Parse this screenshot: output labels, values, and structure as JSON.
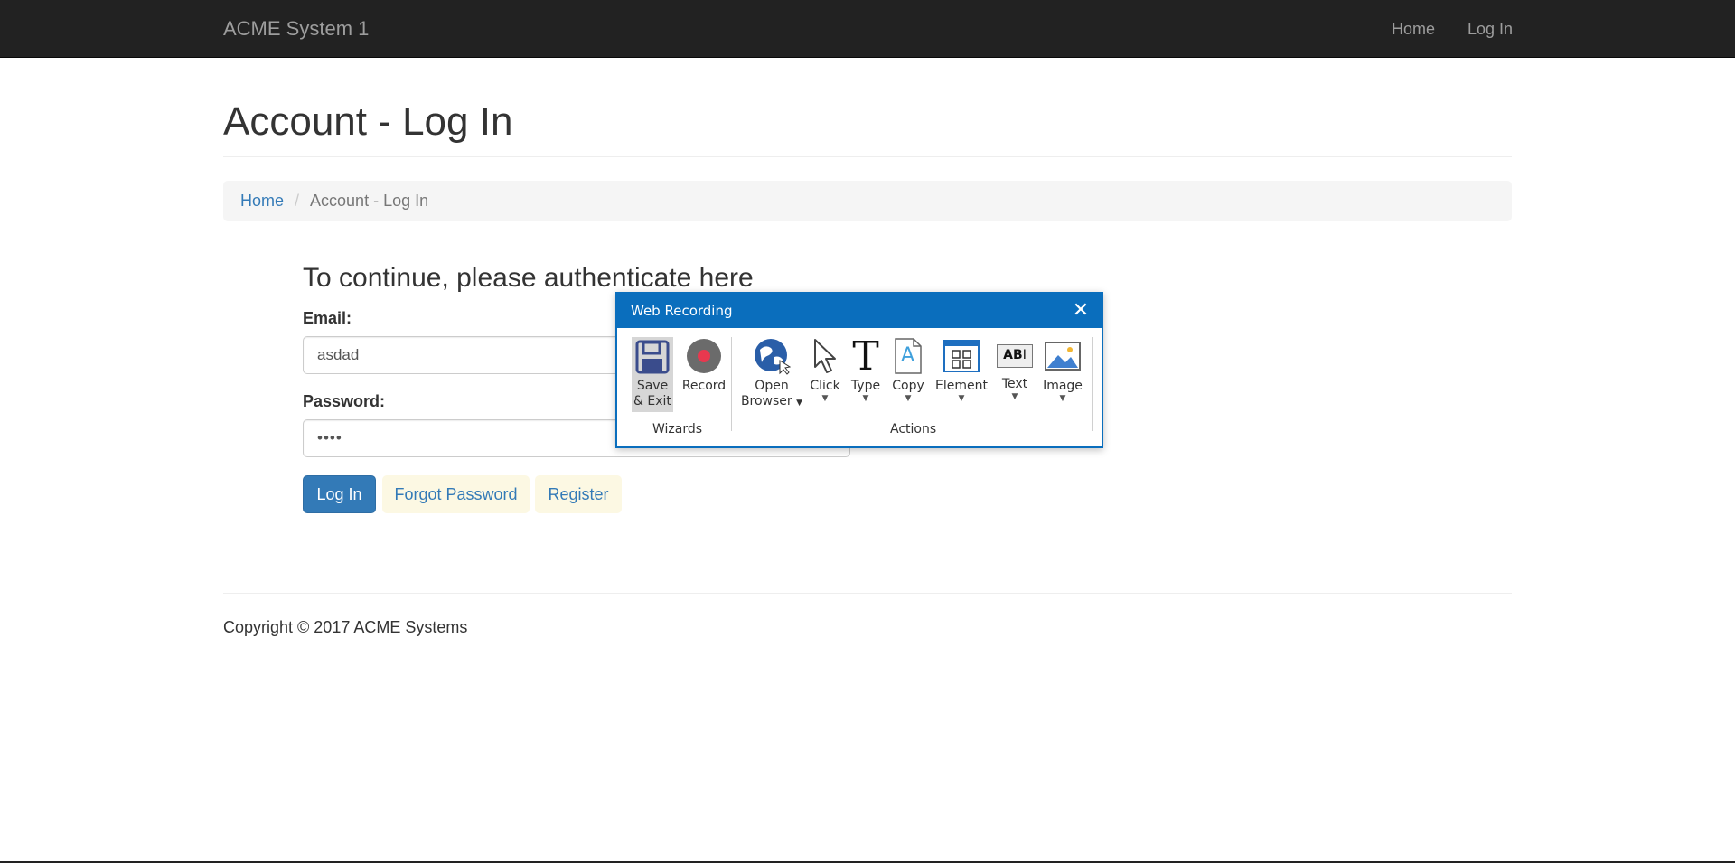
{
  "navbar": {
    "brand": "ACME System 1",
    "links": [
      "Home",
      "Log In"
    ]
  },
  "page": {
    "title": "Account - Log In"
  },
  "breadcrumb": {
    "home": "Home",
    "separator": "/",
    "current": "Account - Log In"
  },
  "login": {
    "lead": "To continue, please authenticate here",
    "email_label": "Email:",
    "email_value": "asdad",
    "password_label": "Password:",
    "password_value": "••••",
    "login_button": "Log In",
    "forgot_button": "Forgot Password",
    "register_button": "Register"
  },
  "footer": {
    "copyright": "Copyright © 2017 ACME Systems"
  },
  "recorder": {
    "title": "Web Recording",
    "close_icon": "close-icon",
    "tools": {
      "save": [
        "Save",
        "& Exit"
      ],
      "record": "Record",
      "open_browser": [
        "Open",
        "Browser"
      ],
      "click": "Click",
      "type": "Type",
      "copy": "Copy",
      "element": "Element",
      "text": "Text",
      "image": "Image"
    },
    "icons": {
      "save": "floppy-disk-icon",
      "record": "record-icon",
      "open_browser": "globe-icon",
      "click": "cursor-icon",
      "type": "type-T-icon",
      "copy": "copy-document-icon",
      "element": "element-grid-icon",
      "text": "text-field-icon",
      "image": "image-icon"
    },
    "text_icon_glyph": "AB",
    "type_icon_glyph": "T",
    "copy_icon_glyph": "A",
    "groups": {
      "wizards": "Wizards",
      "actions": "Actions"
    }
  },
  "colors": {
    "navbar": "#222222",
    "link": "#337ab7",
    "primary_button": "#337ab7",
    "recorder_accent": "#0a6ebd",
    "record_dot": "#e8384f"
  }
}
